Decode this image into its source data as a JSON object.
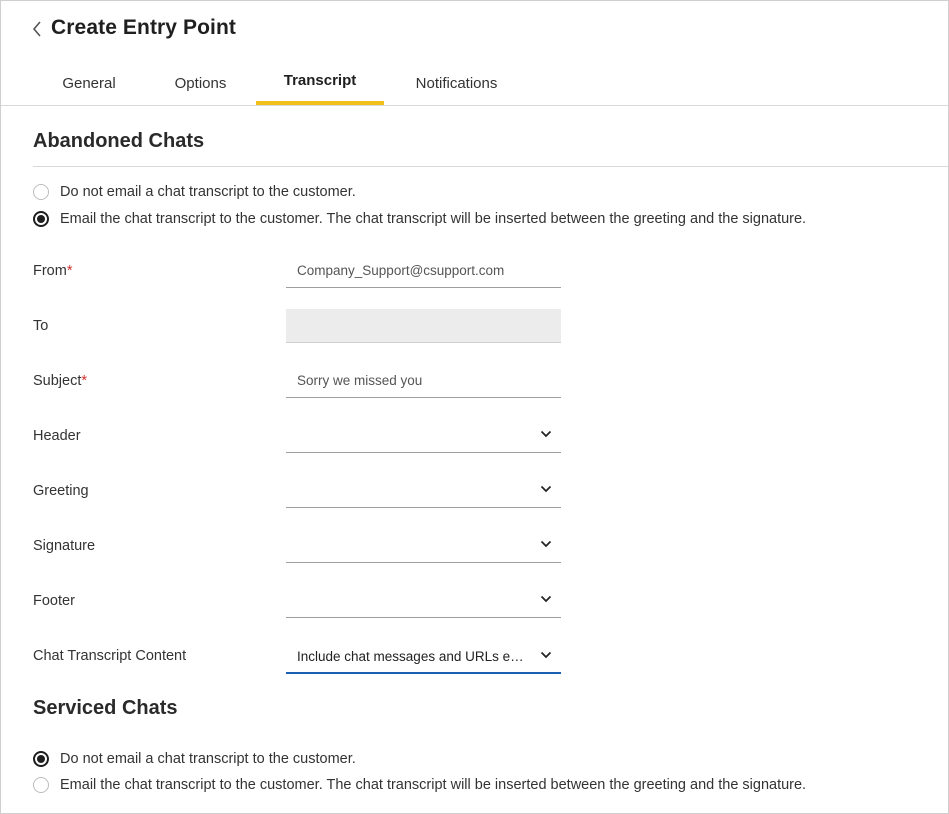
{
  "header": {
    "back_icon": "chevron-left-icon",
    "title": "Create Entry Point"
  },
  "tabs": [
    {
      "label": "General",
      "active": false
    },
    {
      "label": "Options",
      "active": false
    },
    {
      "label": "Transcript",
      "active": true
    },
    {
      "label": "Notifications",
      "active": false
    }
  ],
  "abandoned": {
    "title": "Abandoned Chats",
    "options": [
      {
        "label": "Do not email a chat transcript to the customer.",
        "checked": false
      },
      {
        "label": "Email the chat transcript to the customer. The chat transcript will be inserted between the greeting and the signature.",
        "checked": true
      }
    ],
    "fields": {
      "from": {
        "label": "From",
        "required_mark": "*",
        "value": "Company_Support@csupport.com"
      },
      "to": {
        "label": "To",
        "value": ""
      },
      "subject": {
        "label": "Subject",
        "required_mark": "*",
        "value": "Sorry we missed you"
      },
      "header": {
        "label": "Header",
        "value": ""
      },
      "greeting": {
        "label": "Greeting",
        "value": ""
      },
      "signature": {
        "label": "Signature",
        "value": ""
      },
      "footer": {
        "label": "Footer",
        "value": ""
      },
      "content": {
        "label": "Chat Transcript Content",
        "value": "Include chat messages and URLs exchanged"
      }
    }
  },
  "serviced": {
    "title": "Serviced Chats",
    "options": [
      {
        "label": "Do not email a chat transcript to the customer.",
        "checked": true
      },
      {
        "label": "Email the chat transcript to the customer. The chat transcript will be inserted between the greeting and the signature.",
        "checked": false
      }
    ]
  },
  "colors": {
    "active_tab_underline": "#f2c01e",
    "focus_underline": "#1a5fb4",
    "required": "#d0312d"
  }
}
